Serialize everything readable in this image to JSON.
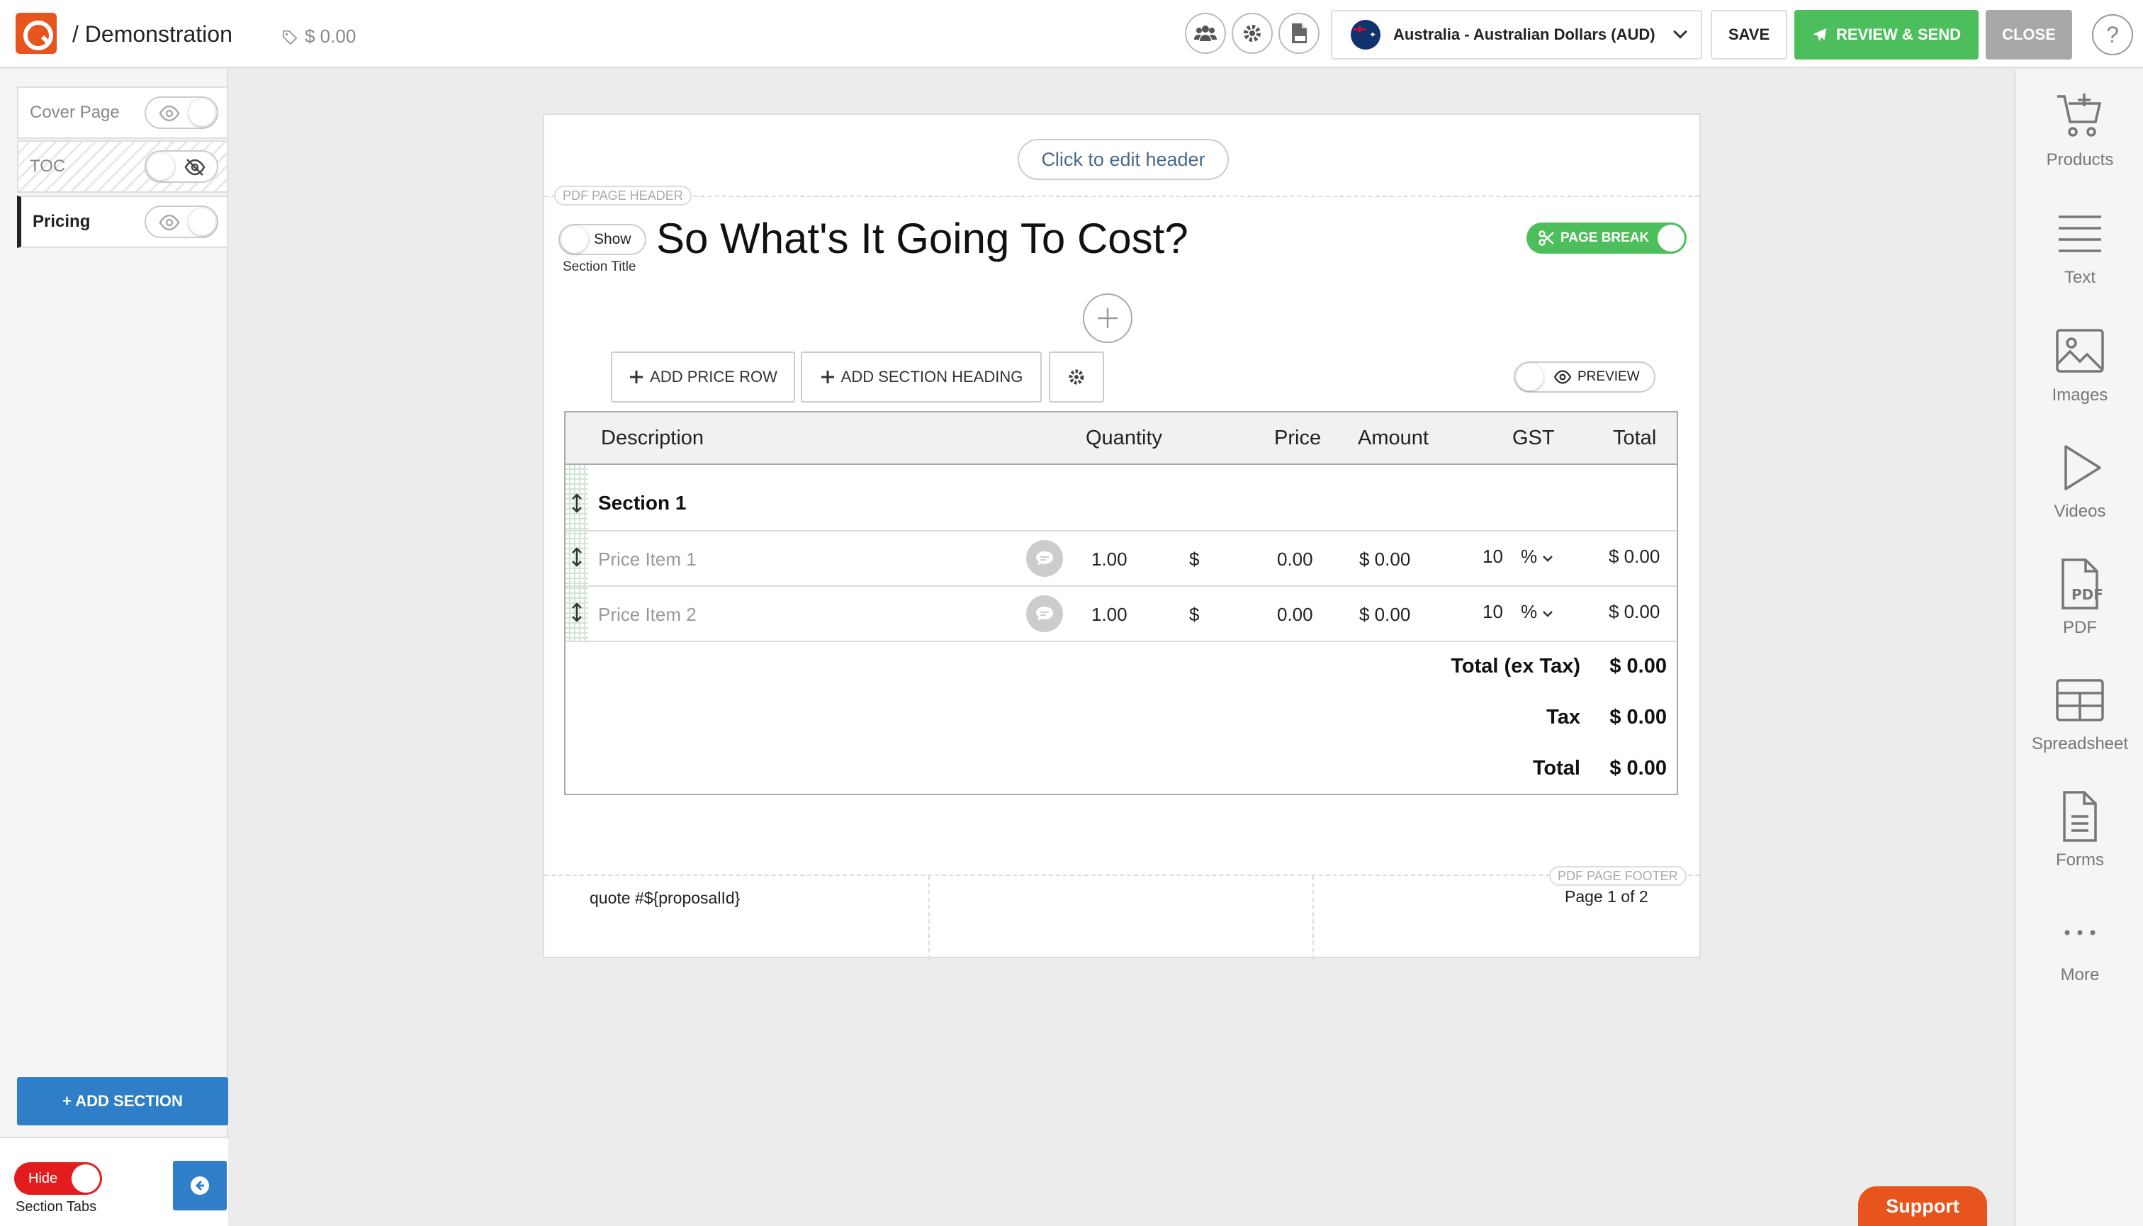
{
  "header": {
    "breadcrumb": "/ Demonstration",
    "price_total": "$ 0.00",
    "currency": "Australia - Australian Dollars (AUD)",
    "save_label": "SAVE",
    "review_label": "REVIEW & SEND",
    "close_label": "CLOSE",
    "help_label": "?"
  },
  "sidebar": {
    "sections": [
      {
        "label": "Cover Page",
        "visible": true
      },
      {
        "label": "TOC",
        "visible": false
      },
      {
        "label": "Pricing",
        "visible": true,
        "active": true
      }
    ],
    "add_section_label": "+ ADD SECTION",
    "hide_toggle_label": "Hide",
    "section_tabs_label": "Section Tabs"
  },
  "tools": [
    {
      "label": "Products",
      "icon": "cart-plus-icon"
    },
    {
      "label": "Text",
      "icon": "text-lines-icon"
    },
    {
      "label": "Images",
      "icon": "image-icon"
    },
    {
      "label": "Videos",
      "icon": "play-icon"
    },
    {
      "label": "PDF",
      "icon": "pdf-file-icon"
    },
    {
      "label": "Spreadsheet",
      "icon": "table-icon"
    },
    {
      "label": "Forms",
      "icon": "form-icon"
    },
    {
      "label": "More",
      "icon": "ellipsis-icon"
    }
  ],
  "document": {
    "edit_header_label": "Click to edit header",
    "pdf_header_label": "PDF PAGE HEADER",
    "show_label": "Show",
    "section_title_label": "Section Title",
    "section_heading": "So What's It Going To Cost?",
    "page_break_label": "PAGE BREAK",
    "add_price_row_label": "ADD PRICE ROW",
    "add_section_heading_label": "ADD SECTION HEADING",
    "preview_label": "PREVIEW",
    "pdf_footer_label": "PDF PAGE FOOTER",
    "footer_left": "quote #${proposalId}",
    "footer_right": "Page 1 of 2"
  },
  "pricing_table": {
    "columns": [
      "Description",
      "Quantity",
      "Price",
      "Amount",
      "GST",
      "Total"
    ],
    "section_name": "Section 1",
    "items": [
      {
        "description": "Price Item 1",
        "quantity": "1.00",
        "price_symbol": "$",
        "price": "0.00",
        "amount": "$ 0.00",
        "gst": "10",
        "gst_unit": "%",
        "total": "$ 0.00"
      },
      {
        "description": "Price Item 2",
        "quantity": "1.00",
        "price_symbol": "$",
        "price": "0.00",
        "amount": "$ 0.00",
        "gst": "10",
        "gst_unit": "%",
        "total": "$ 0.00"
      }
    ],
    "totals": {
      "subtotal_label": "Total (ex Tax)",
      "subtotal_value": "$ 0.00",
      "tax_label": "Tax",
      "tax_value": "$ 0.00",
      "total_label": "Total",
      "total_value": "$ 0.00"
    }
  },
  "support_label": "Support",
  "colors": {
    "brand_orange": "#e8541e",
    "accent_green": "#4cbf5c",
    "accent_blue": "#2f7fc8",
    "hide_red": "#e31d1d"
  }
}
